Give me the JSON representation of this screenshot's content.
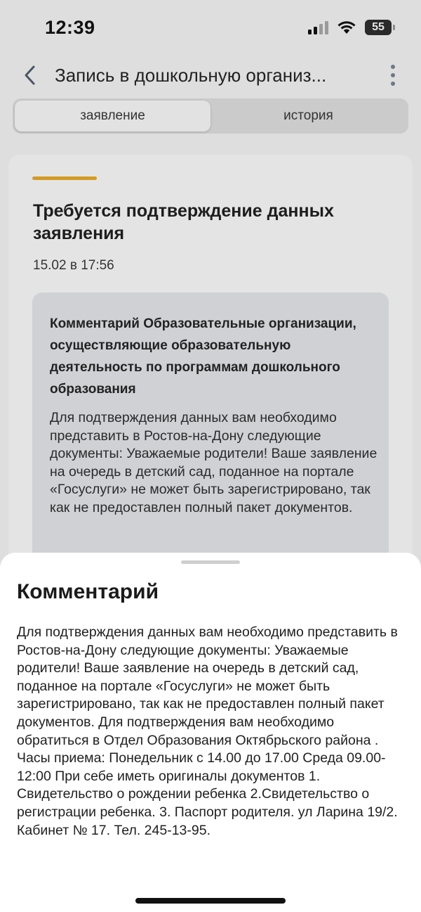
{
  "status_bar": {
    "time": "12:39",
    "battery": "55"
  },
  "header": {
    "title": "Запись в дошкольную организ...",
    "back_icon": "chevron-left-icon",
    "more_icon": "vertical-dots-icon"
  },
  "tabs": [
    {
      "label": "заявление",
      "active": true
    },
    {
      "label": "история",
      "active": false
    }
  ],
  "card": {
    "accent_color": "#d49a22",
    "title": "Требуется подтверждение данных заявления",
    "date": "15.02 в 17:56",
    "comment_heading": "Комментарий Образовательные организации, осуществляющие образовательную деятельность по программам дошкольного образования",
    "comment_text": "Для подтверждения данных вам необходимо представить в Ростов-на-Дону следующие документы: Уважаемые родители! Ваше заявление на очередь в детский сад, поданное на портале «Госуслуги» не может быть зарегистрировано, так как не предоставлен полный пакет документов."
  },
  "sheet": {
    "title": "Комментарий",
    "text": "Для подтверждения данных вам необходимо представить в Ростов-на-Дону следующие документы: Уважаемые родители! Ваше заявление на очередь в детский сад, поданное на портале «Госуслуги» не может быть зарегистрировано, так как не предоставлен полный пакет документов. Для подтверждения вам необходимо обратиться в Отдел Образования Октябрьского района . Часы приема: Понедельник с 14.00 до 17.00 Среда 09.00-12:00 При себе иметь оригиналы документов 1. Свидетельство о рождении ребенка 2.Свидетельство о регистрации ребенка. 3. Паспорт родителя. ул Ларина 19/2. Кабинет № 17. Тел. 245-13-95."
  }
}
